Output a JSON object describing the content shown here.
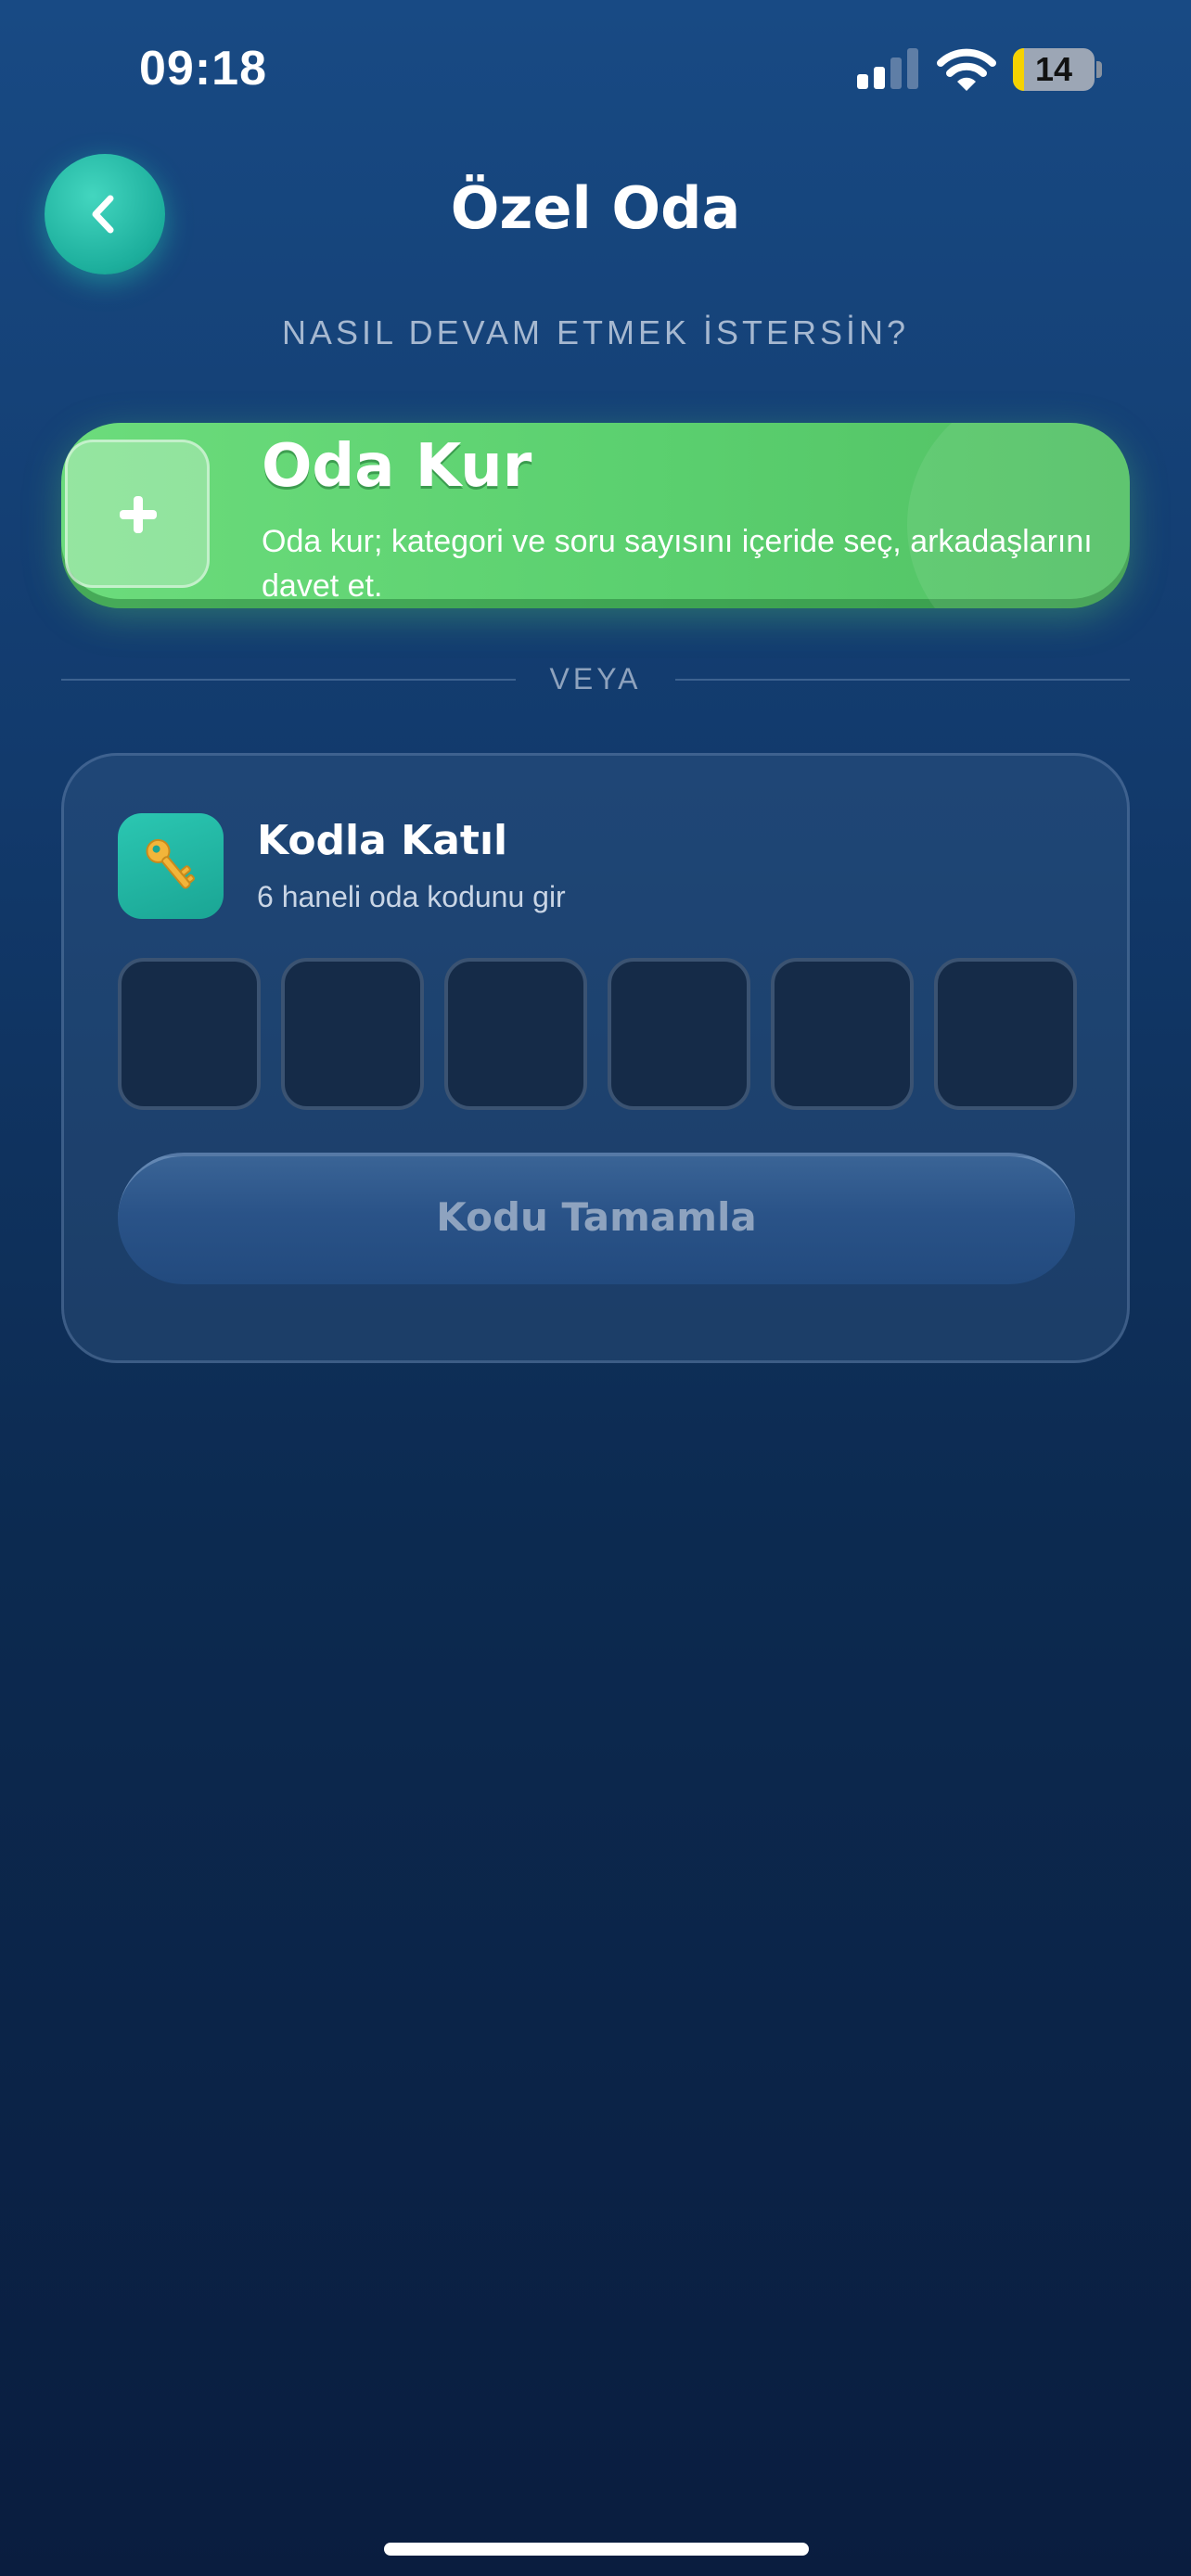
{
  "status_bar": {
    "time": "09:18",
    "battery_level": "14",
    "battery_percent": 14
  },
  "header": {
    "title": "Özel Oda",
    "back_icon": "chevron-left-icon"
  },
  "prompt": "NASIL DEVAM ETMEK İSTERSİN?",
  "create_room": {
    "title": "Oda Kur",
    "description": "Oda kur; kategori ve soru sayısını içeride seç, arkadaşlarını davet et.",
    "icon": "plus-icon"
  },
  "divider": {
    "label": "VEYA"
  },
  "join_room": {
    "title": "Kodla Katıl",
    "subtitle": "6 haneli oda kodunu gir",
    "icon": "key-icon",
    "code_digits": [
      "",
      "",
      "",
      "",
      "",
      ""
    ],
    "submit_label": "Kodu Tamamla"
  },
  "colors": {
    "accent_teal": "#1cae9c",
    "create_green": "#5bd06f",
    "key_gold": "#f2b53a"
  }
}
